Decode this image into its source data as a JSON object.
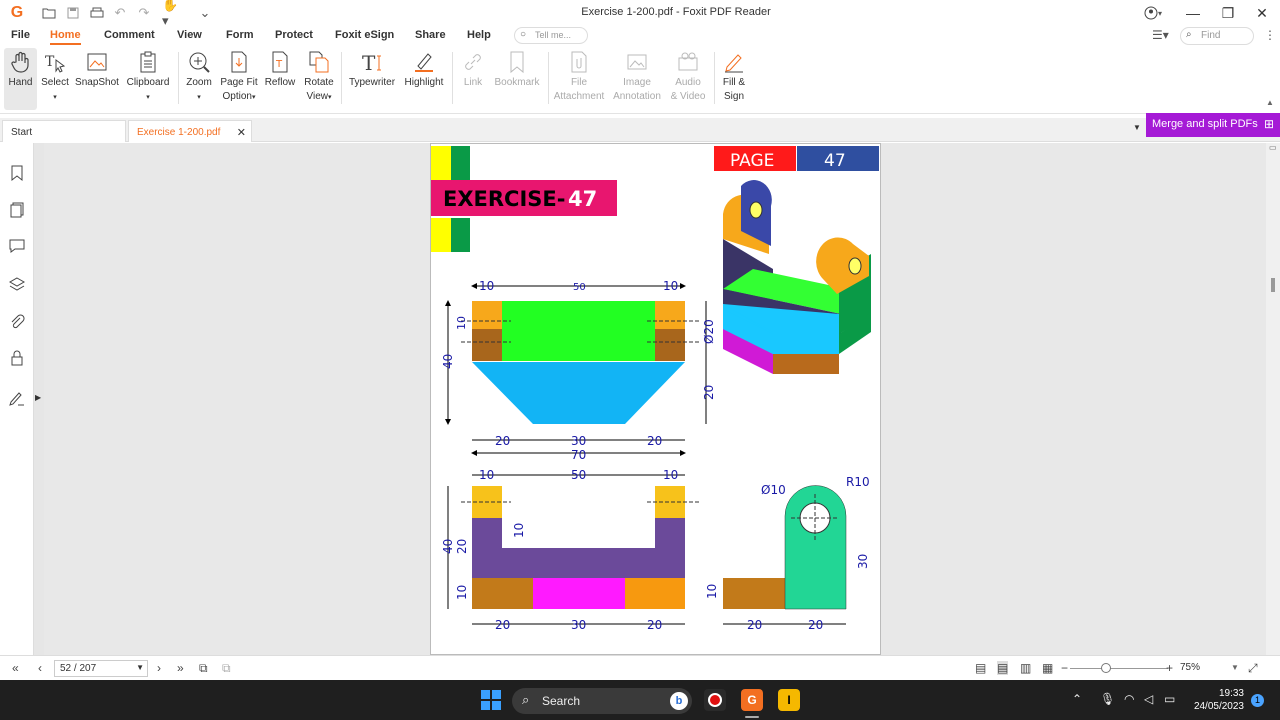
{
  "window": {
    "title": "Exercise 1-200.pdf - Foxit PDF Reader"
  },
  "menu": {
    "tabs": [
      "File",
      "Home",
      "Comment",
      "View",
      "Form",
      "Protect",
      "Foxit eSign",
      "Share",
      "Help"
    ],
    "active": "Home",
    "tell_me_placeholder": "Tell me...",
    "find_placeholder": "Find"
  },
  "ribbon": {
    "hand": "Hand",
    "select": "Select",
    "snapshot": "SnapShot",
    "clipboard": "Clipboard",
    "zoom": "Zoom",
    "page_fit_1": "Page Fit",
    "page_fit_2": "Option",
    "reflow": "Reflow",
    "rotate_1": "Rotate",
    "rotate_2": "View",
    "typewriter": "Typewriter",
    "highlight": "Highlight",
    "link": "Link",
    "bookmark": "Bookmark",
    "file_att_1": "File",
    "file_att_2": "Attachment",
    "image_ann_1": "Image",
    "image_ann_2": "Annotation",
    "audio_1": "Audio",
    "audio_2": "& Video",
    "fill_1": "Fill &",
    "fill_2": "Sign"
  },
  "tabs": {
    "start": "Start",
    "file": "Exercise 1-200.pdf"
  },
  "merge_button": "Merge and split PDFs",
  "document": {
    "page_label": "PAGE",
    "page_number": "47",
    "exercise_prefix": "EXERCISE-",
    "exercise_number": "47",
    "dims": {
      "d10": "10",
      "d50": "50",
      "d20": "20",
      "d30": "30",
      "d40": "40",
      "d70": "70",
      "phi20": "Ø20",
      "phi10": "Ø10",
      "r10": "R10"
    }
  },
  "status": {
    "page": "52 / 207",
    "zoom": "75%"
  },
  "taskbar": {
    "search": "Search",
    "time": "19:33",
    "date": "24/05/2023",
    "notifications": "1"
  },
  "colors": {
    "accent": "#f36f21",
    "merge": "#a51ad6",
    "exercise_bg": "#e8166f",
    "page_red": "#ff1a1a",
    "page_blue": "#2f4fa0"
  }
}
